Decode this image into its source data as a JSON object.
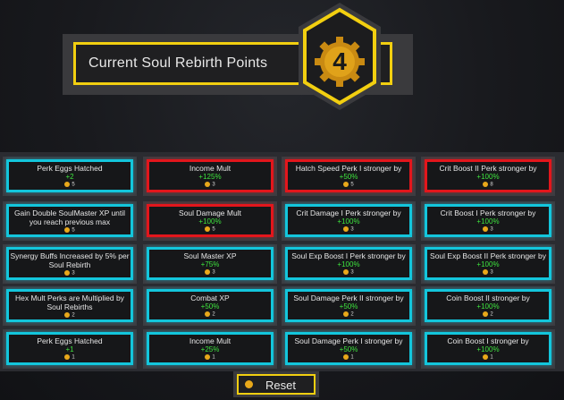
{
  "header": {
    "title": "Current Soul Rebirth Points",
    "points": "4"
  },
  "cards": [
    {
      "title": "Perk Eggs Hatched",
      "value": "+2",
      "cost": "5",
      "color": "cyan"
    },
    {
      "title": "Income Mult",
      "value": "+125%",
      "cost": "3",
      "color": "red"
    },
    {
      "title": "Hatch Speed Perk I stronger by",
      "value": "+50%",
      "cost": "5",
      "color": "red"
    },
    {
      "title": "Crit Boost  II Perk stronger by",
      "value": "+100%",
      "cost": "8",
      "color": "red"
    },
    {
      "title": "Gain Double SoulMaster XP until you reach previous max",
      "value": "",
      "cost": "5",
      "color": "cyan"
    },
    {
      "title": "Soul Damage Mult",
      "value": "+100%",
      "cost": "5",
      "color": "red"
    },
    {
      "title": "Crit Damage I Perk stronger by",
      "value": "+100%",
      "cost": "3",
      "color": "cyan"
    },
    {
      "title": "Crit Boost  I Perk stronger by",
      "value": "+100%",
      "cost": "3",
      "color": "cyan"
    },
    {
      "title": "Synergy Buffs Increased by 5% per Soul Rebirth",
      "value": "",
      "cost": "3",
      "color": "cyan"
    },
    {
      "title": "Soul Master XP",
      "value": "+75%",
      "cost": "3",
      "color": "cyan"
    },
    {
      "title": "Soul Exp Boost I Perk stronger by",
      "value": "+100%",
      "cost": "3",
      "color": "cyan"
    },
    {
      "title": "Soul Exp Boost II Perk stronger by",
      "value": "+100%",
      "cost": "3",
      "color": "cyan"
    },
    {
      "title": "Hex Mult Perks are Multiplied by Soul Rebirths",
      "value": "",
      "cost": "2",
      "color": "cyan"
    },
    {
      "title": "Combat XP",
      "value": "+50%",
      "cost": "2",
      "color": "cyan"
    },
    {
      "title": "Soul Damage Perk II stronger by",
      "value": "+50%",
      "cost": "2",
      "color": "cyan"
    },
    {
      "title": "Coin Boost II stronger by",
      "value": "+100%",
      "cost": "2",
      "color": "cyan"
    },
    {
      "title": "Perk Eggs Hatched",
      "value": "+1",
      "cost": "1",
      "color": "cyan"
    },
    {
      "title": "Income Mult",
      "value": "+25%",
      "cost": "1",
      "color": "cyan"
    },
    {
      "title": "Soul Damage Perk I stronger by",
      "value": "+50%",
      "cost": "1",
      "color": "cyan"
    },
    {
      "title": "Coin Boost I stronger by",
      "value": "+100%",
      "cost": "1",
      "color": "cyan"
    }
  ],
  "reset": {
    "label": "Reset"
  },
  "colors": {
    "accent": "#f2cf10",
    "cyan": "#13c6dc",
    "red": "#e3161c",
    "value_green": "#3ee33e"
  }
}
